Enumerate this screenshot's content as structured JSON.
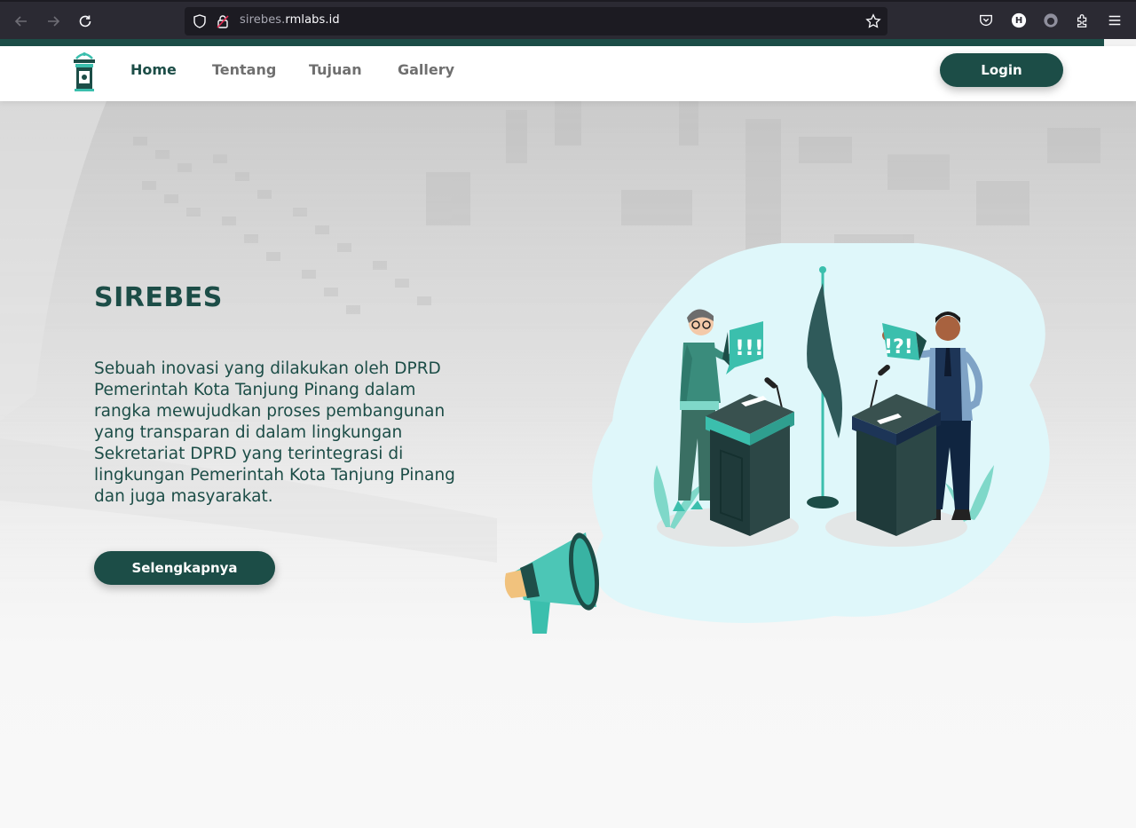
{
  "browser": {
    "url_prefix": "sirebes.",
    "url_domain": "rmlabs.id",
    "profile_initial": "H"
  },
  "navbar": {
    "links": [
      {
        "label": "Home",
        "active": true
      },
      {
        "label": "Tentang",
        "active": false
      },
      {
        "label": "Tujuan",
        "active": false
      },
      {
        "label": "Gallery",
        "active": false
      }
    ],
    "login_label": "Login"
  },
  "hero": {
    "title": "SIREBES",
    "description": "Sebuah inovasi yang dilakukan oleh DPRD Pemerintah Kota Tanjung Pinang dalam rangka mewujudkan proses pembangunan yang transparan di dalam lingkungan Sekretariat DPRD yang terintegrasi di lingkungan Pemerintah Kota Tanjung Pinang dan juga masyarakat.",
    "button_label": "Selengkapnya",
    "bubble_left": "!!!",
    "bubble_right": "!?!"
  },
  "colors": {
    "primary": "#1c4d47",
    "chrome_bg": "#2b2a33",
    "accent_teal": "#3bbfad",
    "blob": "#dff7fa"
  }
}
